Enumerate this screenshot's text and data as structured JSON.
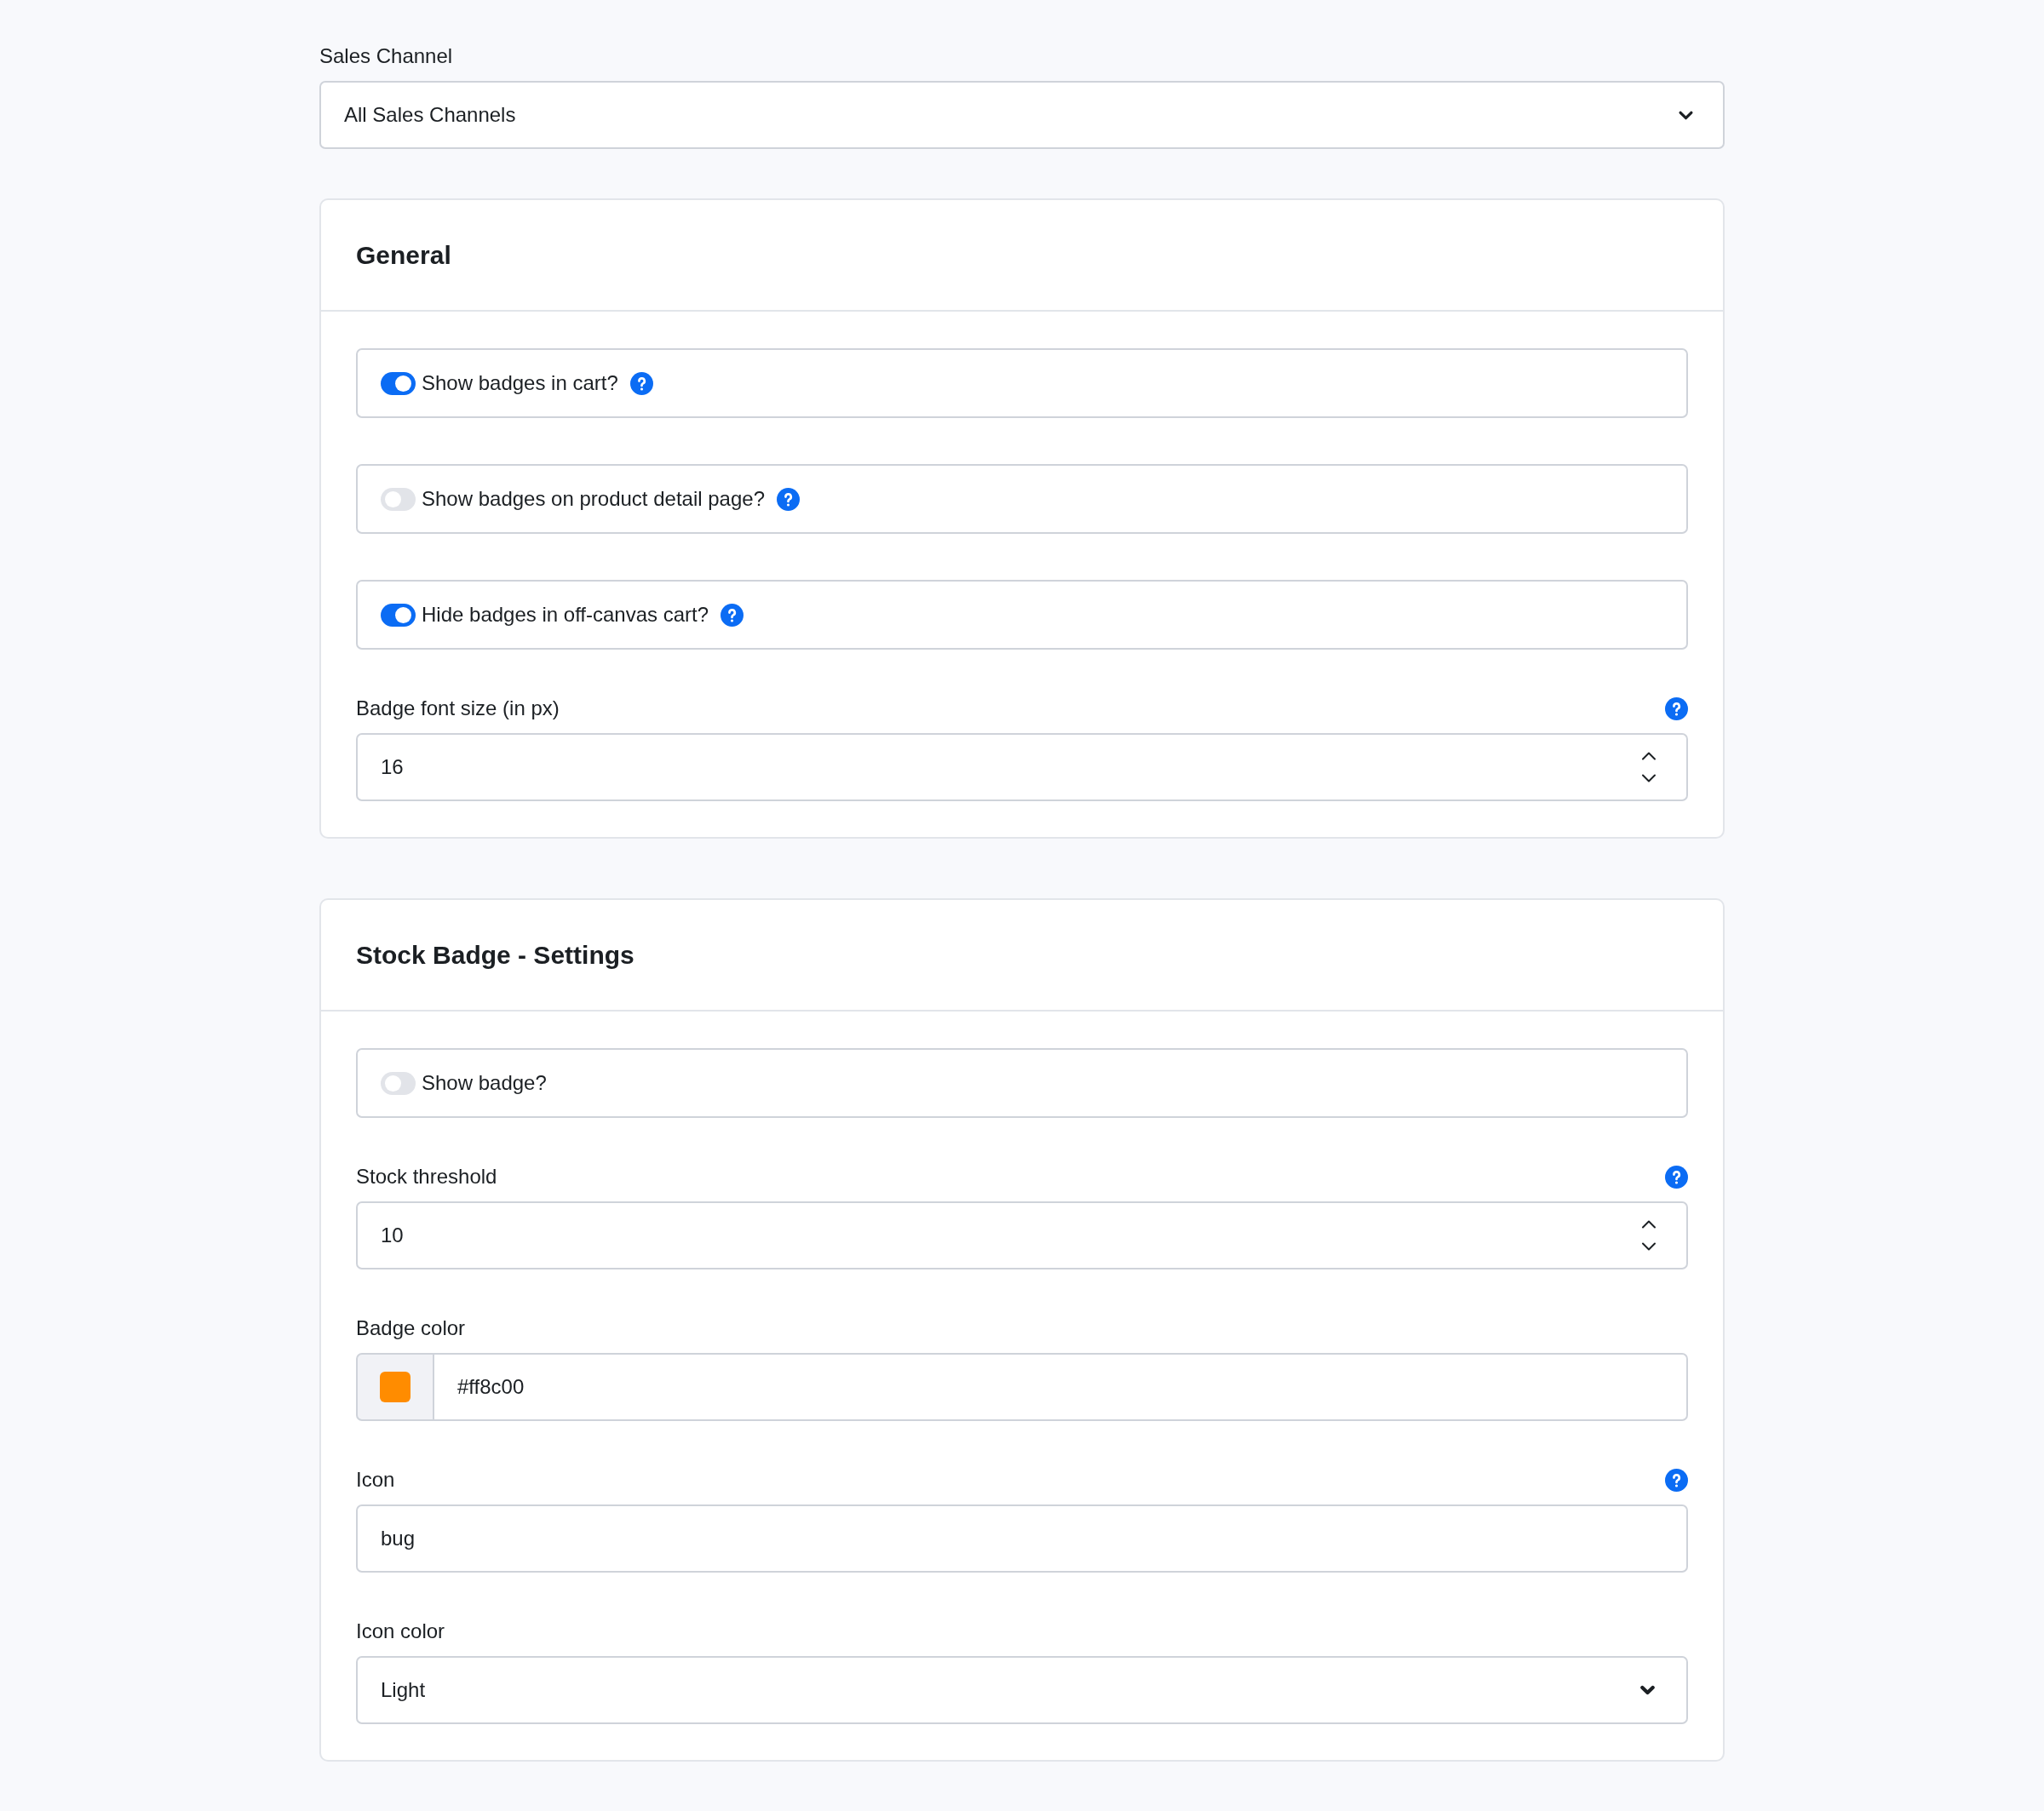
{
  "sales_channel": {
    "label": "Sales Channel",
    "value": "All Sales Channels"
  },
  "cards": [
    {
      "title": "General",
      "fields": [
        {
          "kind": "toggle",
          "label": "Show badges in cart?",
          "on": true,
          "help": true
        },
        {
          "kind": "toggle",
          "label": "Show badges on product detail page?",
          "on": false,
          "help": true
        },
        {
          "kind": "toggle",
          "label": "Hide badges in off-canvas cart?",
          "on": true,
          "help": true
        },
        {
          "kind": "number",
          "label": "Badge font size (in px)",
          "value": "16",
          "help": true
        }
      ]
    },
    {
      "title": "Stock Badge - Settings",
      "fields": [
        {
          "kind": "toggle",
          "label": "Show badge?",
          "on": false
        },
        {
          "kind": "number",
          "label": "Stock threshold",
          "value": "10",
          "help": true
        },
        {
          "kind": "color",
          "label": "Badge color",
          "value": "#ff8c00",
          "color": "#ff8c00"
        },
        {
          "kind": "text",
          "label": "Icon",
          "value": "bug",
          "help": true
        },
        {
          "kind": "select",
          "label": "Icon color",
          "value": "Light"
        }
      ]
    }
  ]
}
